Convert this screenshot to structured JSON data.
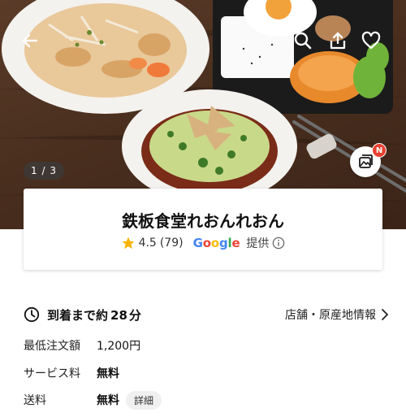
{
  "hero": {
    "photo_counter": "1 / 3",
    "gallery_badge": "N"
  },
  "store": {
    "name": "鉄板食堂れおんれおん",
    "rating": "4.5",
    "review_count": "(79)",
    "google_letters": [
      "G",
      "o",
      "o",
      "g",
      "l",
      "e"
    ],
    "provided_label": "提供"
  },
  "delivery": {
    "time_text": "到着まで約",
    "time_value": "28",
    "time_unit": "分",
    "store_info_link": "店舗・原産地情報"
  },
  "info": {
    "min_order_label": "最低注文額",
    "min_order_value": "1,200円",
    "service_fee_label": "サービス料",
    "service_fee_value": "無料",
    "delivery_fee_label": "送料",
    "delivery_fee_value": "無料",
    "detail_chip": "詳細"
  },
  "colors": {
    "star": "#F5B400",
    "badge": "#E8402F",
    "google_blue": "#4285F4",
    "google_red": "#EA4335",
    "google_yellow": "#FBBC05",
    "google_green": "#34A853"
  },
  "icons": [
    "back-arrow-icon",
    "search-icon",
    "share-icon",
    "heart-icon",
    "gallery-icon",
    "star-icon",
    "info-icon",
    "clock-icon",
    "chevron-right-icon"
  ]
}
